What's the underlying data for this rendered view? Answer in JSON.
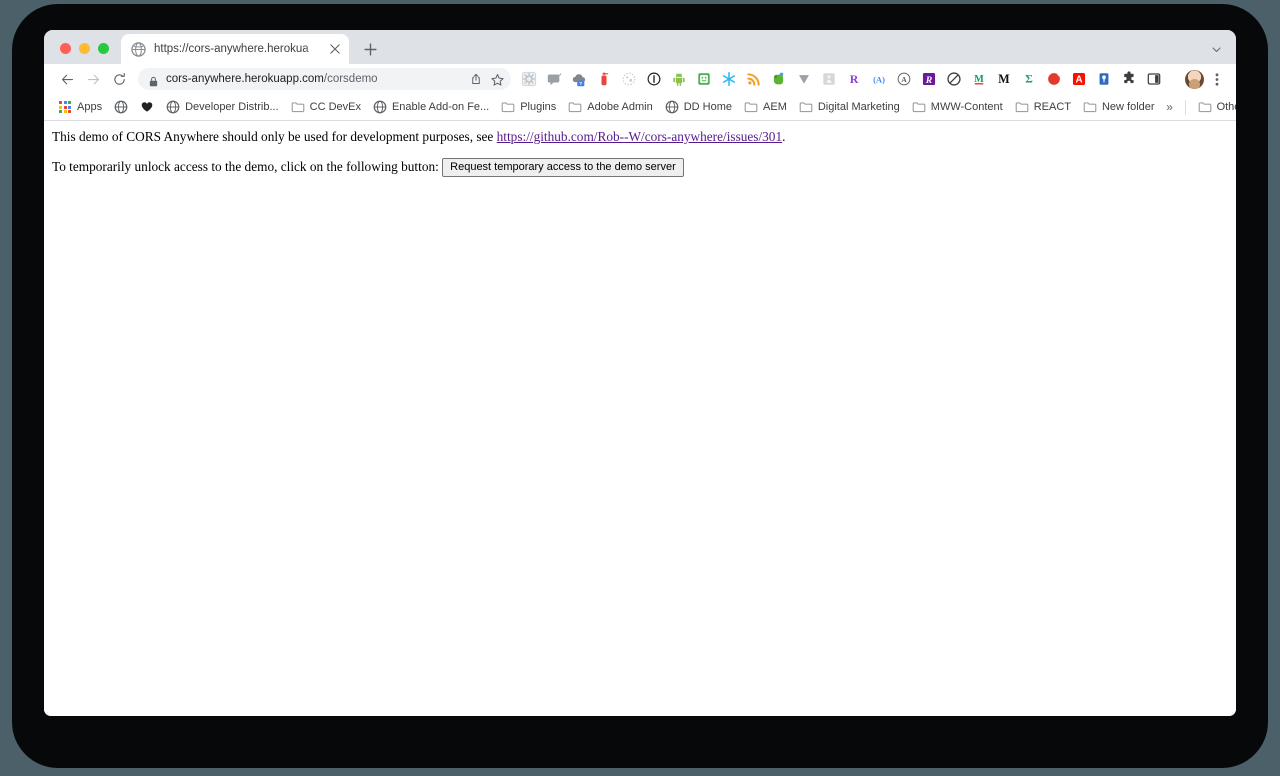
{
  "window": {
    "traffic_lights": [
      {
        "name": "close",
        "color": "#ff5f57"
      },
      {
        "name": "minimize",
        "color": "#febc2e"
      },
      {
        "name": "zoom",
        "color": "#28c840"
      }
    ]
  },
  "tabstrip": {
    "active_tab": {
      "title": "https://cors-anywhere.herokua",
      "favicon": "globe-icon",
      "close_label": "×"
    },
    "new_tab_label": "+",
    "tab_list_label": "˅"
  },
  "toolbar": {
    "back_label": "←",
    "forward_label": "→",
    "reload_label": "↻",
    "security_icon": "lock-icon",
    "url_host": "cors-anywhere.herokuapp.com",
    "url_path": "/corsdemo",
    "share_label": "⇧",
    "bookmark_star_label": "☆",
    "menu_label": "⋮",
    "extensions": [
      {
        "name": "grid-gear-extension",
        "glyph": "⚙",
        "color": "#c8ccd1",
        "badge": ""
      },
      {
        "name": "chat-bubble-extension",
        "glyph": "▭",
        "color": "#9aa0a6",
        "badge": ""
      },
      {
        "name": "cloud-extension",
        "glyph": "☁",
        "color": "#80868b",
        "badge": "?"
      },
      {
        "name": "fire-extinguisher-extension",
        "glyph": "▮",
        "color": "#e8453c",
        "badge": ""
      },
      {
        "name": "dotted-circle-extension",
        "glyph": "◌",
        "color": "#bdc1c6",
        "badge": ""
      },
      {
        "name": "info-circle-extension",
        "glyph": "ⓘ",
        "color": "#202124",
        "badge": ""
      },
      {
        "name": "android-robot-extension",
        "glyph": "●",
        "color": "#8ac24a",
        "badge": ""
      },
      {
        "name": "screen-smiley-extension",
        "glyph": "▣",
        "color": "#4caf50",
        "badge": ""
      },
      {
        "name": "snowflake-extension",
        "glyph": "✳",
        "color": "#29b6f6",
        "badge": ""
      },
      {
        "name": "rss-feed-extension",
        "glyph": "◠",
        "color": "#f4a024",
        "badge": ""
      },
      {
        "name": "evernote-elephant-extension",
        "glyph": "●",
        "color": "#5bb431",
        "badge": ""
      },
      {
        "name": "vimeo-v-extension",
        "glyph": "V",
        "color": "#9aa0a6",
        "badge": ""
      },
      {
        "name": "person-square-extension",
        "glyph": "⚑",
        "color": "#bdc1c6",
        "badge": ""
      },
      {
        "name": "letter-r-extension",
        "glyph": "R",
        "color": "#8e3fd4",
        "badge": ""
      },
      {
        "name": "a-parentheses-extension",
        "glyph": "(A)",
        "color": "#4285f4",
        "badge": ""
      },
      {
        "name": "circled-a-extension",
        "glyph": "Ⓐ",
        "color": "#5f6368",
        "badge": ""
      },
      {
        "name": "script-r-extension",
        "glyph": "ℛ",
        "color": "#6a1b9a",
        "badge": ""
      },
      {
        "name": "blocked-extension",
        "glyph": "⊘",
        "color": "#3c4043",
        "badge": ""
      },
      {
        "name": "mendeley-m-extension",
        "glyph": "M",
        "color": "#0b9e5e",
        "badge": ""
      },
      {
        "name": "medium-m-extension",
        "glyph": "M",
        "color": "#111111",
        "badge": ""
      },
      {
        "name": "sigma-extension",
        "glyph": "Σ",
        "color": "#1aa179",
        "badge": ""
      },
      {
        "name": "crescent-extension",
        "glyph": "◔",
        "color": "#e23b2e",
        "badge": ""
      },
      {
        "name": "adobe-a-extension",
        "glyph": "A",
        "color": "#ffffff",
        "badge": ""
      },
      {
        "name": "lastpass-vault-extension",
        "glyph": "⚿",
        "color": "#ffffff",
        "badge": ""
      },
      {
        "name": "puzzle-piece-extension",
        "glyph": "❖",
        "color": "#3c4043",
        "badge": ""
      },
      {
        "name": "sidepanel-extension",
        "glyph": "□",
        "color": "#3c4043",
        "badge": ""
      }
    ]
  },
  "bookmarks": {
    "items": [
      {
        "label": "Apps",
        "icon": "apps-grid-icon",
        "icon_only": false
      },
      {
        "label": "",
        "icon": "globe-icon",
        "icon_only": true
      },
      {
        "label": "",
        "icon": "heart-icon",
        "icon_only": true
      },
      {
        "label": "Developer Distrib...",
        "icon": "globe-icon",
        "icon_only": false
      },
      {
        "label": "CC DevEx",
        "icon": "folder-icon",
        "icon_only": false
      },
      {
        "label": "Enable Add-on Fe...",
        "icon": "globe-icon",
        "icon_only": false
      },
      {
        "label": "Plugins",
        "icon": "folder-icon",
        "icon_only": false
      },
      {
        "label": "Adobe Admin",
        "icon": "folder-icon",
        "icon_only": false
      },
      {
        "label": "DD Home",
        "icon": "globe-icon",
        "icon_only": false
      },
      {
        "label": "AEM",
        "icon": "folder-icon",
        "icon_only": false
      },
      {
        "label": "Digital Marketing",
        "icon": "folder-icon",
        "icon_only": false
      },
      {
        "label": "MWW-Content",
        "icon": "folder-icon",
        "icon_only": false
      },
      {
        "label": "REACT",
        "icon": "folder-icon",
        "icon_only": false
      },
      {
        "label": "New folder",
        "icon": "folder-icon",
        "icon_only": false
      }
    ],
    "overflow_label": "»",
    "other_bookmarks": {
      "label": "Other Bookmarks",
      "icon": "folder-icon"
    }
  },
  "page": {
    "line1_before": "This demo of CORS Anywhere should only be used for development purposes, see ",
    "link_text": "https://github.com/Rob--W/cors-anywhere/issues/301",
    "line1_after": ".",
    "line2_before": "To temporarily unlock access to the demo, click on the following button: ",
    "button_label": "Request temporary access to the demo server"
  }
}
